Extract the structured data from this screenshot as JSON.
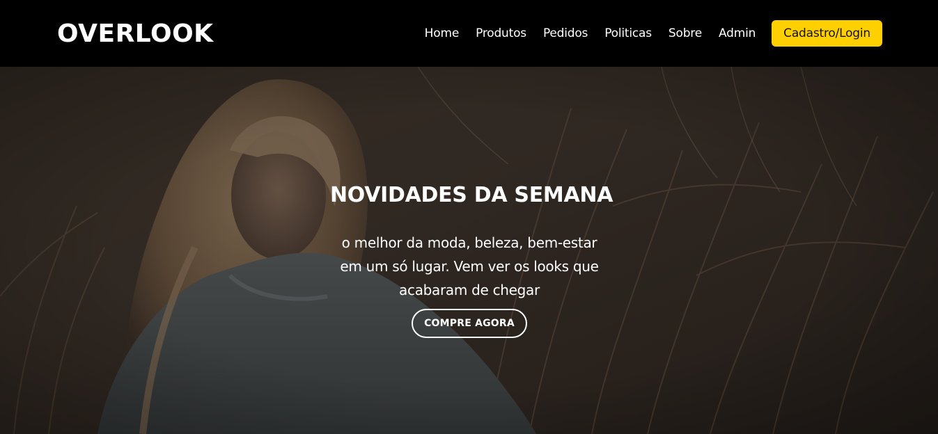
{
  "header": {
    "brand": "OVERLOOK",
    "nav": [
      "Home",
      "Produtos",
      "Pedidos",
      "Politicas",
      "Sobre",
      "Admin"
    ],
    "login_label": "Cadastro/Login",
    "accent_color": "#ffd000"
  },
  "hero": {
    "title": "NOVIDADES DA SEMANA",
    "text": "o melhor da moda, beleza, bem-estar em um só lugar. Vem ver os looks que acabaram de chegar",
    "cta_label": "COMPRE AGORA"
  }
}
